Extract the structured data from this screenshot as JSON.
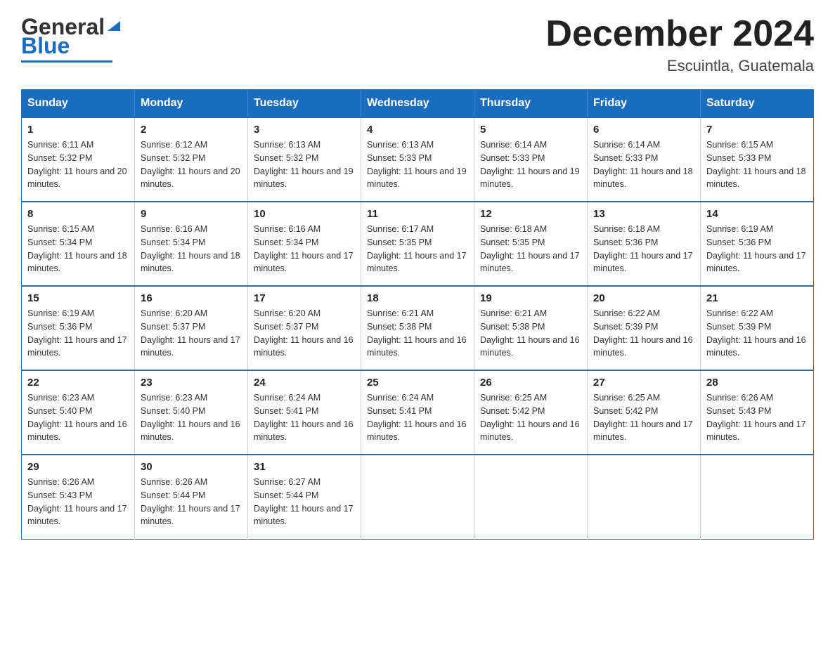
{
  "logo": {
    "general": "General",
    "blue": "Blue",
    "tagline": ""
  },
  "title": "December 2024",
  "subtitle": "Escuintla, Guatemala",
  "days": [
    "Sunday",
    "Monday",
    "Tuesday",
    "Wednesday",
    "Thursday",
    "Friday",
    "Saturday"
  ],
  "weeks": [
    [
      {
        "day": "1",
        "sunrise": "6:11 AM",
        "sunset": "5:32 PM",
        "daylight": "11 hours and 20 minutes."
      },
      {
        "day": "2",
        "sunrise": "6:12 AM",
        "sunset": "5:32 PM",
        "daylight": "11 hours and 20 minutes."
      },
      {
        "day": "3",
        "sunrise": "6:13 AM",
        "sunset": "5:32 PM",
        "daylight": "11 hours and 19 minutes."
      },
      {
        "day": "4",
        "sunrise": "6:13 AM",
        "sunset": "5:33 PM",
        "daylight": "11 hours and 19 minutes."
      },
      {
        "day": "5",
        "sunrise": "6:14 AM",
        "sunset": "5:33 PM",
        "daylight": "11 hours and 19 minutes."
      },
      {
        "day": "6",
        "sunrise": "6:14 AM",
        "sunset": "5:33 PM",
        "daylight": "11 hours and 18 minutes."
      },
      {
        "day": "7",
        "sunrise": "6:15 AM",
        "sunset": "5:33 PM",
        "daylight": "11 hours and 18 minutes."
      }
    ],
    [
      {
        "day": "8",
        "sunrise": "6:15 AM",
        "sunset": "5:34 PM",
        "daylight": "11 hours and 18 minutes."
      },
      {
        "day": "9",
        "sunrise": "6:16 AM",
        "sunset": "5:34 PM",
        "daylight": "11 hours and 18 minutes."
      },
      {
        "day": "10",
        "sunrise": "6:16 AM",
        "sunset": "5:34 PM",
        "daylight": "11 hours and 17 minutes."
      },
      {
        "day": "11",
        "sunrise": "6:17 AM",
        "sunset": "5:35 PM",
        "daylight": "11 hours and 17 minutes."
      },
      {
        "day": "12",
        "sunrise": "6:18 AM",
        "sunset": "5:35 PM",
        "daylight": "11 hours and 17 minutes."
      },
      {
        "day": "13",
        "sunrise": "6:18 AM",
        "sunset": "5:36 PM",
        "daylight": "11 hours and 17 minutes."
      },
      {
        "day": "14",
        "sunrise": "6:19 AM",
        "sunset": "5:36 PM",
        "daylight": "11 hours and 17 minutes."
      }
    ],
    [
      {
        "day": "15",
        "sunrise": "6:19 AM",
        "sunset": "5:36 PM",
        "daylight": "11 hours and 17 minutes."
      },
      {
        "day": "16",
        "sunrise": "6:20 AM",
        "sunset": "5:37 PM",
        "daylight": "11 hours and 17 minutes."
      },
      {
        "day": "17",
        "sunrise": "6:20 AM",
        "sunset": "5:37 PM",
        "daylight": "11 hours and 16 minutes."
      },
      {
        "day": "18",
        "sunrise": "6:21 AM",
        "sunset": "5:38 PM",
        "daylight": "11 hours and 16 minutes."
      },
      {
        "day": "19",
        "sunrise": "6:21 AM",
        "sunset": "5:38 PM",
        "daylight": "11 hours and 16 minutes."
      },
      {
        "day": "20",
        "sunrise": "6:22 AM",
        "sunset": "5:39 PM",
        "daylight": "11 hours and 16 minutes."
      },
      {
        "day": "21",
        "sunrise": "6:22 AM",
        "sunset": "5:39 PM",
        "daylight": "11 hours and 16 minutes."
      }
    ],
    [
      {
        "day": "22",
        "sunrise": "6:23 AM",
        "sunset": "5:40 PM",
        "daylight": "11 hours and 16 minutes."
      },
      {
        "day": "23",
        "sunrise": "6:23 AM",
        "sunset": "5:40 PM",
        "daylight": "11 hours and 16 minutes."
      },
      {
        "day": "24",
        "sunrise": "6:24 AM",
        "sunset": "5:41 PM",
        "daylight": "11 hours and 16 minutes."
      },
      {
        "day": "25",
        "sunrise": "6:24 AM",
        "sunset": "5:41 PM",
        "daylight": "11 hours and 16 minutes."
      },
      {
        "day": "26",
        "sunrise": "6:25 AM",
        "sunset": "5:42 PM",
        "daylight": "11 hours and 16 minutes."
      },
      {
        "day": "27",
        "sunrise": "6:25 AM",
        "sunset": "5:42 PM",
        "daylight": "11 hours and 17 minutes."
      },
      {
        "day": "28",
        "sunrise": "6:26 AM",
        "sunset": "5:43 PM",
        "daylight": "11 hours and 17 minutes."
      }
    ],
    [
      {
        "day": "29",
        "sunrise": "6:26 AM",
        "sunset": "5:43 PM",
        "daylight": "11 hours and 17 minutes."
      },
      {
        "day": "30",
        "sunrise": "6:26 AM",
        "sunset": "5:44 PM",
        "daylight": "11 hours and 17 minutes."
      },
      {
        "day": "31",
        "sunrise": "6:27 AM",
        "sunset": "5:44 PM",
        "daylight": "11 hours and 17 minutes."
      },
      null,
      null,
      null,
      null
    ]
  ],
  "labels": {
    "sunrise": "Sunrise: ",
    "sunset": "Sunset: ",
    "daylight": "Daylight: "
  }
}
